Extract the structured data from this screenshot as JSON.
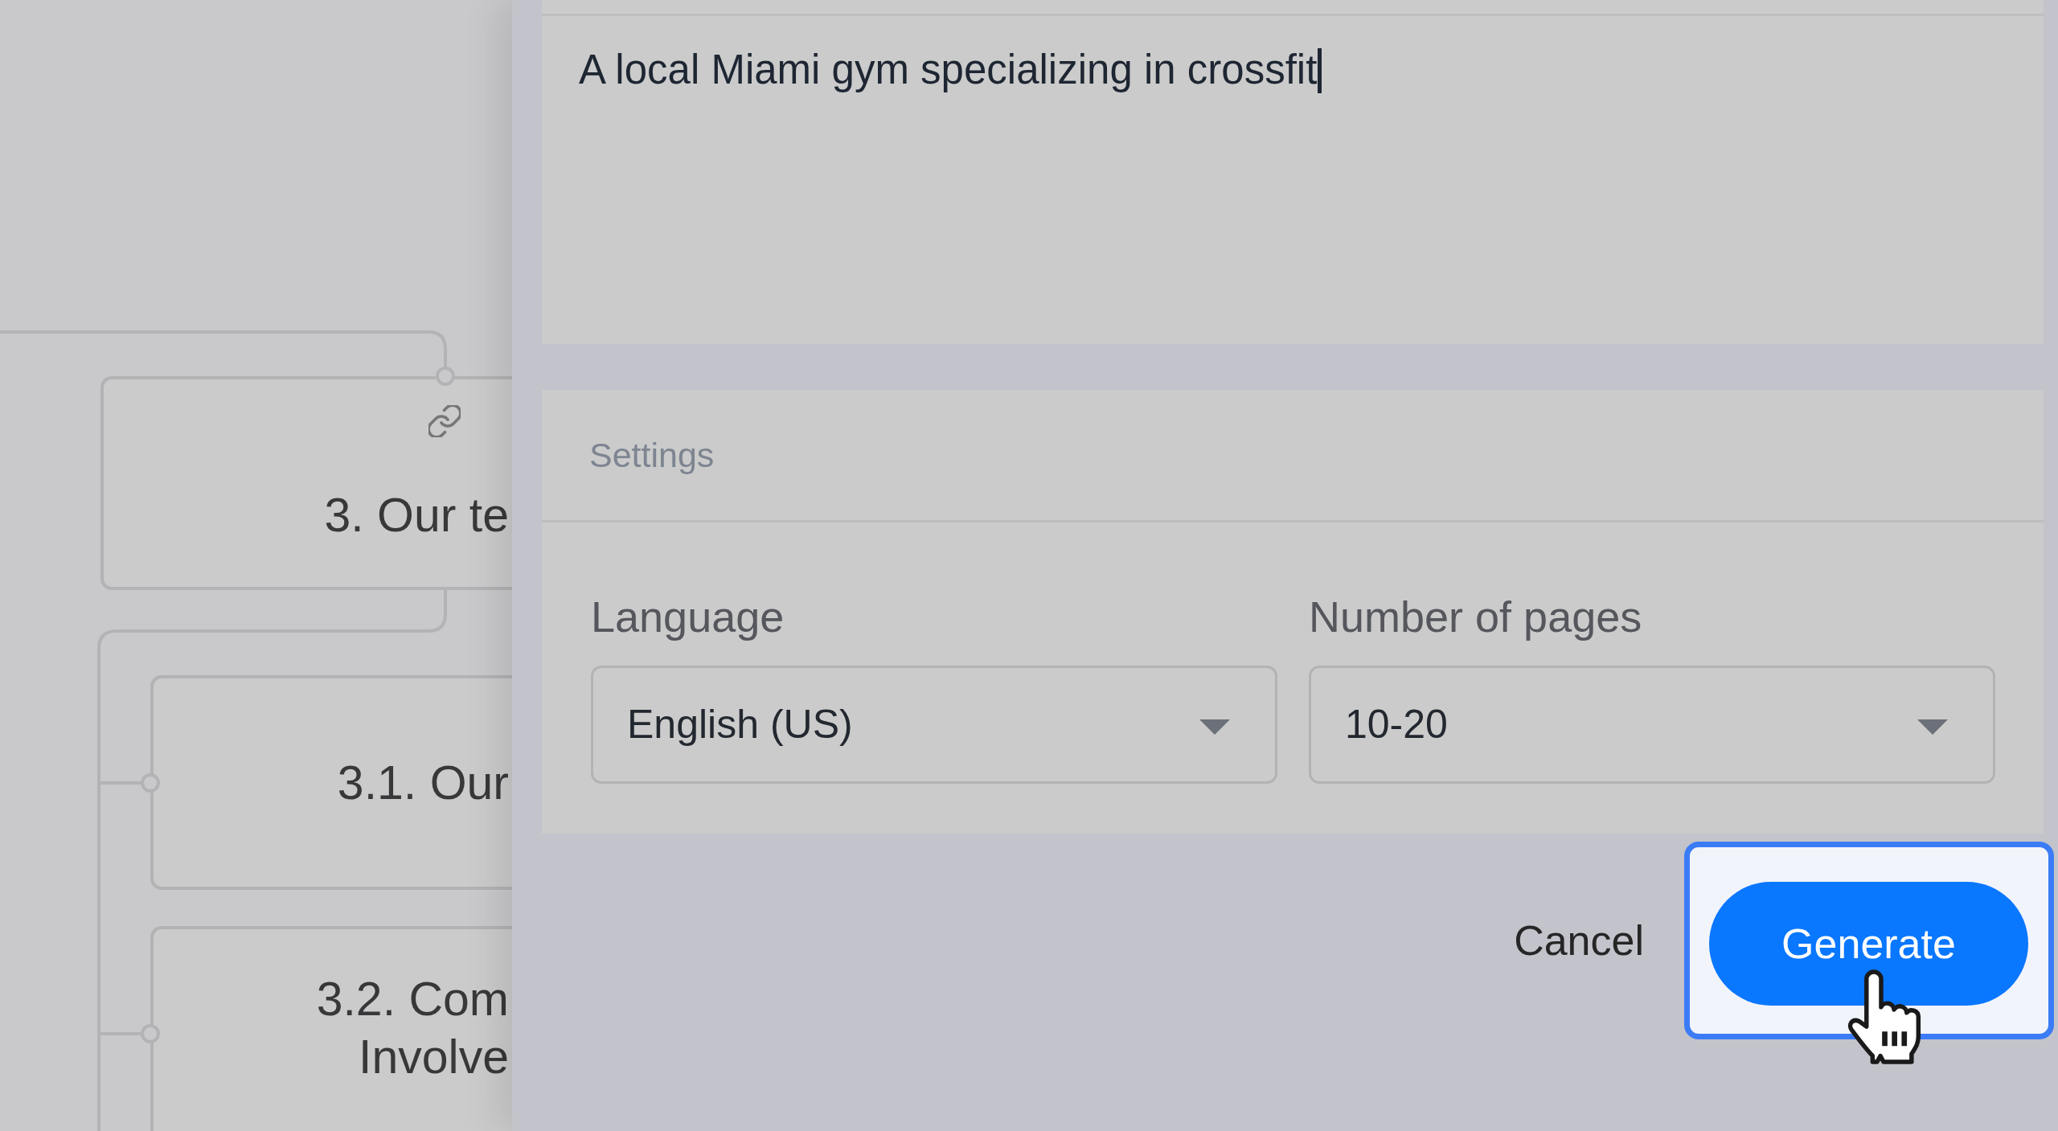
{
  "outline": {
    "nodes": [
      {
        "title": "3. Our te",
        "linked": true,
        "children": [
          {
            "title": "3.1. Our",
            "linked": false
          },
          {
            "title": "3.2. Com\nInvolve",
            "linked": false
          }
        ]
      }
    ]
  },
  "description": {
    "value": "A local Miami gym specializing in crossfit",
    "focused": true
  },
  "settings": {
    "title": "Settings",
    "fields": [
      {
        "label": "Language",
        "value": "English (US)"
      },
      {
        "label": "Number of pages",
        "value": "10-20"
      }
    ]
  },
  "actions": [
    {
      "label": "Cancel",
      "kind": "text",
      "highlighted": false,
      "hovered": false
    },
    {
      "label": "Generate",
      "kind": "primary",
      "highlighted": true,
      "hovered": true
    }
  ]
}
